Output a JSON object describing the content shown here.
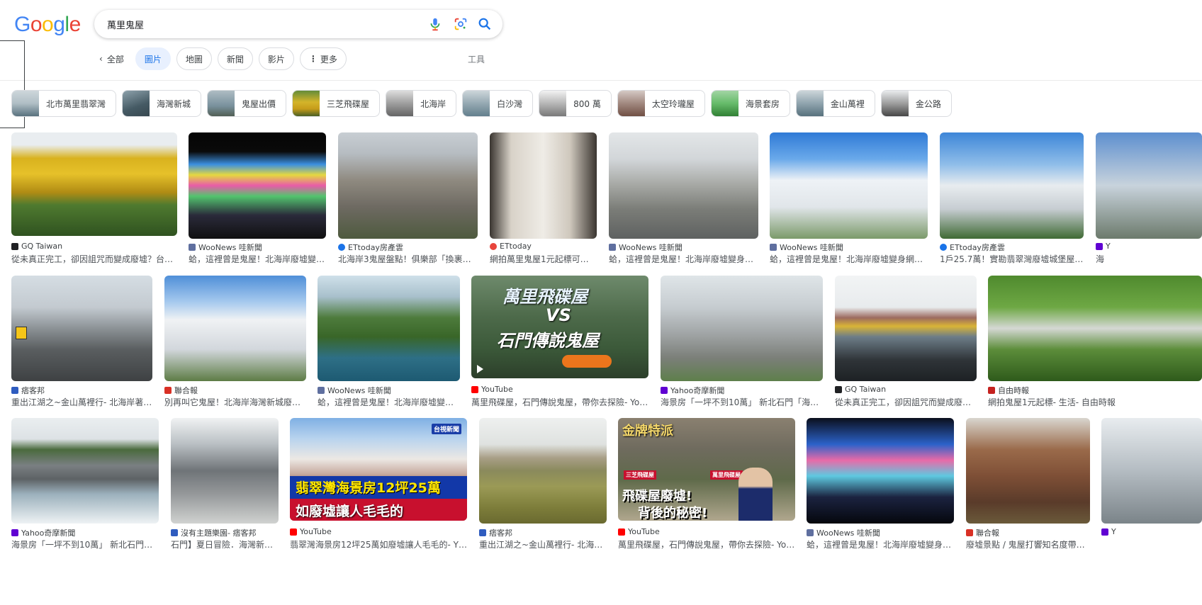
{
  "logo": "Google",
  "search": {
    "query": "萬里鬼屋"
  },
  "tabs": {
    "back_label": "全部",
    "items": [
      "圖片",
      "地圖",
      "新聞",
      "影片",
      "更多"
    ],
    "tools": "工具"
  },
  "related": [
    "北市萬里翡翠灣",
    "海灣新城",
    "鬼屋出價",
    "三芝飛碟屋",
    "北海岸",
    "白沙灣",
    "800 萬",
    "太空玲瓏屋",
    "海景套房",
    "金山萬裡",
    "金公路"
  ],
  "results": [
    {
      "source": "GQ Taiwan",
      "caption": "從未真正完工，卻因詛咒而變成廢墟？台…"
    },
    {
      "source": "WooNews 哇新聞",
      "caption": "蛤，這裡曾是鬼屋！北海岸廢墟變…"
    },
    {
      "source": "ETtoday房產雲",
      "caption": "北海岸3鬼屋盤點！俱樂部「換裹…"
    },
    {
      "source": "ETtoday",
      "caption": "網拍萬里鬼屋1元起標可用…"
    },
    {
      "source": "WooNews 哇新聞",
      "caption": "蛤，這裡曾是鬼屋！北海岸廢墟變身…"
    },
    {
      "source": "WooNews 哇新聞",
      "caption": "蛤，這裡曾是鬼屋！北海岸廢墟變身網…"
    },
    {
      "source": "ETtoday房產雲",
      "caption": "1戶25.7萬！實勘翡翠灣廢墟城堡屋…"
    },
    {
      "source": "Y",
      "caption": "海"
    },
    {
      "source": "痞客邦",
      "caption": "重出江湖之~金山萬裡行- 北海岸著…"
    },
    {
      "source": "聯合報",
      "caption": "別再叫它鬼屋！北海岸海灣新城廢…"
    },
    {
      "source": "WooNews 哇新聞",
      "caption": "蛤，這裡曾是鬼屋！北海岸廢墟變…"
    },
    {
      "source": "YouTube",
      "caption": "萬里飛碟屋，石門傳說鬼屋，帶你去探險- Yo…"
    },
    {
      "source": "Yahoo奇摩新聞",
      "caption": "海景房「一坪不到10萬」 新北石門「海…"
    },
    {
      "source": "GQ Taiwan",
      "caption": "從未真正完工，卻因詛咒而變成廢…"
    },
    {
      "source": "自由時報",
      "caption": "網拍鬼屋1元起標- 生活- 自由時報"
    },
    {
      "source": "Yahoo奇摩新聞",
      "caption": "海景房「一坪不到10萬」 新北石門…"
    },
    {
      "source": "沒有主題樂園- 痞客邦",
      "caption": "石門】夏日冒險．海灣新…"
    },
    {
      "source": "YouTube",
      "caption": "翡翠灣海景房12坪25萬如廢墟讓人毛毛的- Y…"
    },
    {
      "source": "痞客邦",
      "caption": "重出江湖之~金山萬裡行- 北海…"
    },
    {
      "source": "YouTube",
      "caption": "萬里飛碟屋，石門傳說鬼屋，帶你去探險- Yo…"
    },
    {
      "source": "WooNews 哇新聞",
      "caption": "蛤，這裡曾是鬼屋！北海岸廢墟變身…"
    },
    {
      "source": "聯合報",
      "caption": "廢墟景點 / 鬼屋打響知名度帶…"
    },
    {
      "source": "Y",
      "caption": ""
    }
  ],
  "overlays": {
    "youtube1_title_a": "萬里飛碟屋",
    "youtube1_vs": "VS",
    "youtube1_title_b": "石門傳說鬼屋",
    "youtube2_banner_a": "翡翠灣海景房12坪25萬",
    "youtube2_banner_b": "如廢墟讓人毛毛的",
    "youtube2_channel": "台視新聞",
    "youtube3_top": "金牌特派",
    "youtube3_tag_a": "三芝飛碟屋",
    "youtube3_tag_b": "萬里飛碟屋",
    "youtube3_line_a": "飛碟屋廢墟!",
    "youtube3_line_b": "背後的秘密!"
  },
  "colors": {
    "accent": "#1a73e8",
    "chip_active_bg": "#e8f0fe"
  }
}
